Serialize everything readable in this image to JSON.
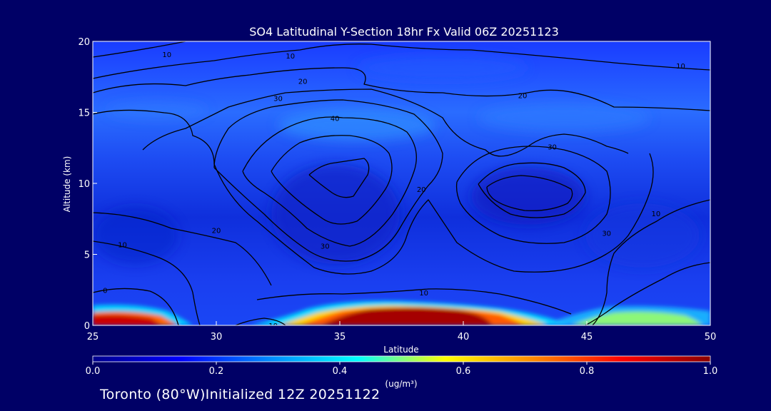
{
  "chart_data": {
    "type": "heatmap",
    "title": "SO4 Latitudinal Y-Section 18hr  Fx Valid 06Z 20251123",
    "xlabel": "Latitude",
    "ylabel": "Altitude (km)",
    "xlim": [
      25,
      50
    ],
    "ylim": [
      0,
      20
    ],
    "x_ticks": [
      25,
      30,
      35,
      40,
      45,
      50
    ],
    "y_ticks": [
      0,
      5,
      10,
      15,
      20
    ],
    "colorbar": {
      "label": "(ug/m³)",
      "range": [
        0.0,
        1.0
      ],
      "ticks": [
        "0.0",
        "0.2",
        "0.4",
        "0.6",
        "0.8",
        "1.0"
      ],
      "colors": [
        "#00008c",
        "#0000ff",
        "#0088ff",
        "#00ffff",
        "#ffff00",
        "#ff8800",
        "#ff0000",
        "#880000"
      ]
    },
    "surface_plumes": [
      {
        "lat_range": [
          25,
          28.5
        ],
        "top_km": 1.4,
        "peak": 1.0
      },
      {
        "lat_range": [
          33,
          43.5
        ],
        "top_km": 1.5,
        "peak": 1.0
      },
      {
        "lat_range": [
          44,
          50
        ],
        "top_km": 1.0,
        "peak": 0.5
      }
    ],
    "contour_labels": [
      {
        "text": "10",
        "lat": 28.0,
        "alt": 19.1
      },
      {
        "text": "10",
        "lat": 33.0,
        "alt": 19.0
      },
      {
        "text": "20",
        "lat": 33.5,
        "alt": 17.2
      },
      {
        "text": "30",
        "lat": 32.5,
        "alt": 16.0
      },
      {
        "text": "40",
        "lat": 34.8,
        "alt": 14.6
      },
      {
        "text": "20",
        "lat": 42.4,
        "alt": 16.2
      },
      {
        "text": "10",
        "lat": 48.8,
        "alt": 18.3
      },
      {
        "text": "30",
        "lat": 43.6,
        "alt": 12.6
      },
      {
        "text": "20",
        "lat": 38.3,
        "alt": 9.6
      },
      {
        "text": "20",
        "lat": 30.0,
        "alt": 6.7
      },
      {
        "text": "30",
        "lat": 34.4,
        "alt": 5.6
      },
      {
        "text": "10",
        "lat": 26.2,
        "alt": 5.7
      },
      {
        "text": "30",
        "lat": 45.8,
        "alt": 6.5
      },
      {
        "text": "10",
        "lat": 47.8,
        "alt": 7.9
      },
      {
        "text": "0",
        "lat": 25.5,
        "alt": 2.5
      },
      {
        "text": "10",
        "lat": 38.4,
        "alt": 2.3
      },
      {
        "text": "10",
        "lat": 32.3,
        "alt": 0.0
      }
    ],
    "grid": false
  },
  "footer": "Toronto (80°W)Initialized 12Z 20251122"
}
